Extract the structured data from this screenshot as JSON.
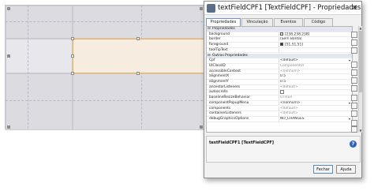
{
  "window": {
    "title": "textFieldCPF1 [TextFieldCPF] - Propriedades"
  },
  "tabs": [
    {
      "label": "Propriedades",
      "active": true
    },
    {
      "label": "Vinculação",
      "active": false
    },
    {
      "label": "Eventos",
      "active": false
    },
    {
      "label": "Código",
      "active": false
    }
  ],
  "categories": {
    "propriedades": "Propriedades",
    "outras": "Outras Propriedades"
  },
  "properties": [
    {
      "name": "background",
      "value": "[238,238,238]",
      "swatch": "#eeeeee"
    },
    {
      "name": "border",
      "value": "(Sem Borda)"
    },
    {
      "name": "foreground",
      "value": "[51,51,51]",
      "swatch": "#333333"
    },
    {
      "name": "toolTipText",
      "value": ""
    }
  ],
  "other_properties": [
    {
      "name": "Cpf",
      "value": "<default>",
      "muted": false,
      "dropdown": true
    },
    {
      "name": "UIClassID",
      "value": "ComponentUI",
      "muted": true
    },
    {
      "name": "accessibleContext",
      "value": "<nenhum>",
      "muted": true
    },
    {
      "name": "alignmentX",
      "value": "0.5"
    },
    {
      "name": "alignmentY",
      "value": "0.5"
    },
    {
      "name": "ancestorListeners",
      "value": "<default>",
      "muted": true
    },
    {
      "name": "autoscrolls",
      "value": "",
      "checkbox": true
    },
    {
      "name": "baselineResizeBehavior",
      "value": "OTHER",
      "muted": true
    },
    {
      "name": "componentPopupMenu",
      "value": "<nenhum>",
      "dropdown": true
    },
    {
      "name": "components",
      "value": "<default>",
      "muted": true
    },
    {
      "name": "containerListeners",
      "value": "<default>",
      "muted": true
    },
    {
      "name": "debugGraphicsOptions",
      "value": "NO_CHANGES",
      "dropdown": true
    }
  ],
  "description": "textFieldCPF1 [TextFieldCPF]",
  "buttons": {
    "close": "Fechar",
    "help": "Ajuda"
  },
  "icons": {
    "help": "?",
    "close": "✕",
    "dropdown": "▾",
    "collapse": "⊟"
  },
  "colors": {
    "selection_border": "#f0b050",
    "active_tab": "#6f93c2",
    "category_bg": "#e2e6ee"
  }
}
